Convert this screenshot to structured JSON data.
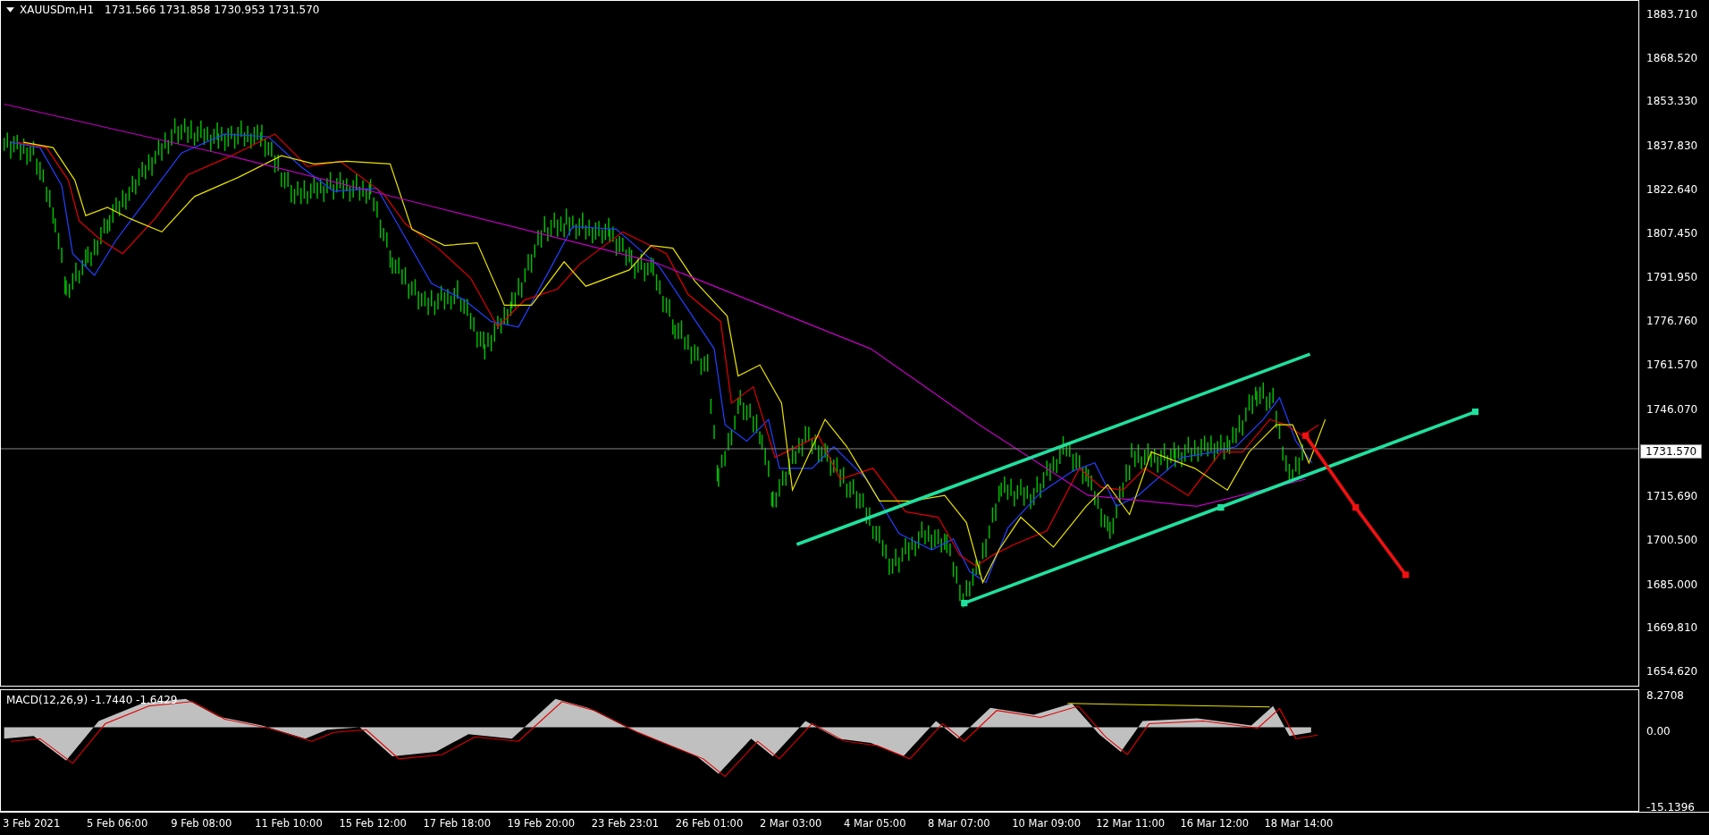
{
  "header": {
    "symbol": "XAUUSDm,H1",
    "quotes": "1731.566 1731.858 1730.953 1731.570"
  },
  "price_axis": [
    {
      "label": "1883.710",
      "kind": "tick"
    },
    {
      "label": "1868.520",
      "kind": "tick"
    },
    {
      "label": "1853.330",
      "kind": "tick"
    },
    {
      "label": "1837.830",
      "kind": "tick"
    },
    {
      "label": "1822.640",
      "kind": "tick"
    },
    {
      "label": "1807.450",
      "kind": "tick"
    },
    {
      "label": "1791.950",
      "kind": "tick"
    },
    {
      "label": "1776.760",
      "kind": "tick"
    },
    {
      "label": "1761.570",
      "kind": "tick"
    },
    {
      "label": "1746.070",
      "kind": "tick"
    },
    {
      "label": "1731.570",
      "kind": "current"
    },
    {
      "label": "1715.690",
      "kind": "tick"
    },
    {
      "label": "1700.500",
      "kind": "tick"
    },
    {
      "label": "1685.000",
      "kind": "tick"
    },
    {
      "label": "1669.810",
      "kind": "tick"
    },
    {
      "label": "1654.620",
      "kind": "tick"
    }
  ],
  "macd": {
    "label": "MACD(12,26,9) -1.7440 -1.6429",
    "axis": [
      "8.2708",
      "0.00",
      "-15.1396"
    ]
  },
  "time_axis": [
    "3 Feb 2021",
    "5 Feb 06:00",
    "9 Feb 08:00",
    "11 Feb 10:00",
    "15 Feb 12:00",
    "17 Feb 18:00",
    "19 Feb 20:00",
    "23 Feb 23:01",
    "26 Feb 01:00",
    "2 Mar 03:00",
    "4 Mar 05:00",
    "8 Mar 07:00",
    "10 Mar 09:00",
    "12 Mar 11:00",
    "16 Mar 12:00",
    "18 Mar 14:00"
  ]
}
